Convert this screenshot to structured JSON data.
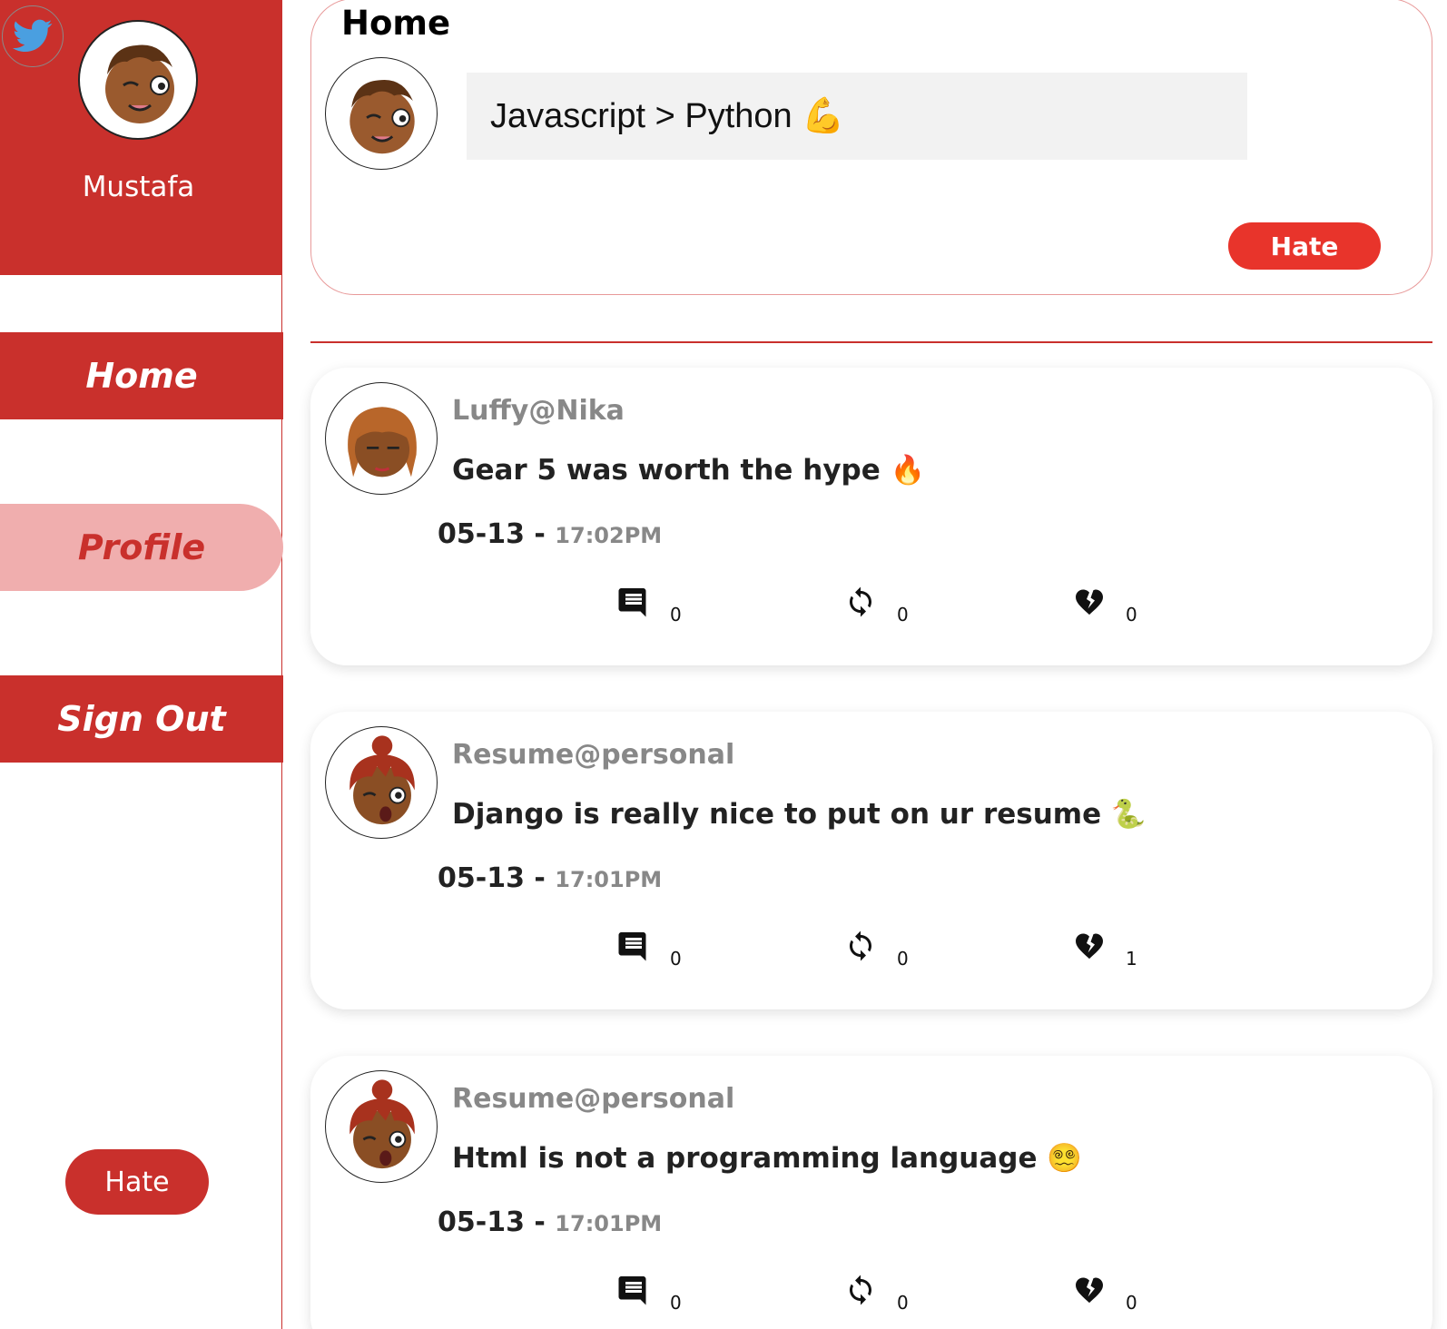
{
  "sidebar": {
    "user_name": "Mustafa",
    "nav": {
      "home": "Home",
      "profile": "Profile",
      "sign_out": "Sign Out"
    },
    "hate_button": "Hate"
  },
  "main": {
    "title": "Home",
    "compose": {
      "value": "Javascript > Python 💪",
      "submit_label": "Hate"
    },
    "tweets": [
      {
        "user": "Luffy@Nika",
        "text": "Gear 5 was worth the hype 🔥",
        "date": "05-13 - ",
        "time": "17:02PM",
        "comments": "0",
        "retweets": "0",
        "hates": "0"
      },
      {
        "user": "Resume@personal",
        "text": "Django is really nice to put on ur resume 🐍",
        "date": "05-13 - ",
        "time": "17:01PM",
        "comments": "0",
        "retweets": "0",
        "hates": "1"
      },
      {
        "user": "Resume@personal",
        "text": "Html is not a programming language 😵‍💫",
        "date": "05-13 - ",
        "time": "17:01PM",
        "comments": "0",
        "retweets": "0",
        "hates": "0"
      }
    ]
  },
  "colors": {
    "brand_red": "#c9302c",
    "hate_red": "#e8342b",
    "profile_pink": "#f0aeae",
    "muted_gray": "#888888"
  },
  "icons": {
    "logo": "twitter-bird-icon",
    "comment": "comment-icon",
    "retweet": "retweet-icon",
    "hate": "broken-heart-icon"
  }
}
